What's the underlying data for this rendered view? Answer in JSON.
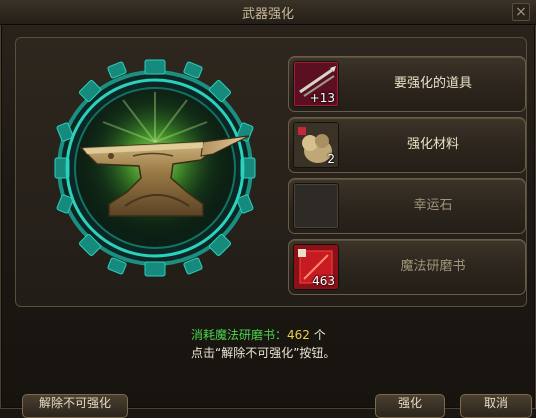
{
  "window": {
    "title": "武器强化"
  },
  "slots": [
    {
      "label": "要强化的道具",
      "count": "+13",
      "icon": "weapon-icon"
    },
    {
      "label": "强化材料",
      "count": "2",
      "icon": "material-bag-icon"
    },
    {
      "label": "幸运石",
      "count": "",
      "icon": "empty-slot"
    },
    {
      "label": "魔法研磨书",
      "count": "463",
      "icon": "magic-book-icon"
    }
  ],
  "info": {
    "consume_label": "消耗魔法研磨书：",
    "consume_value": "462",
    "consume_unit": " 个",
    "hint": "点击“解除不可强化”按钮。"
  },
  "buttons": {
    "unlock": "解除不可强化",
    "enhance": "强化",
    "cancel": "取消"
  },
  "colors": {
    "gear": "#1fb5a2",
    "glow": "#7ac93a"
  }
}
